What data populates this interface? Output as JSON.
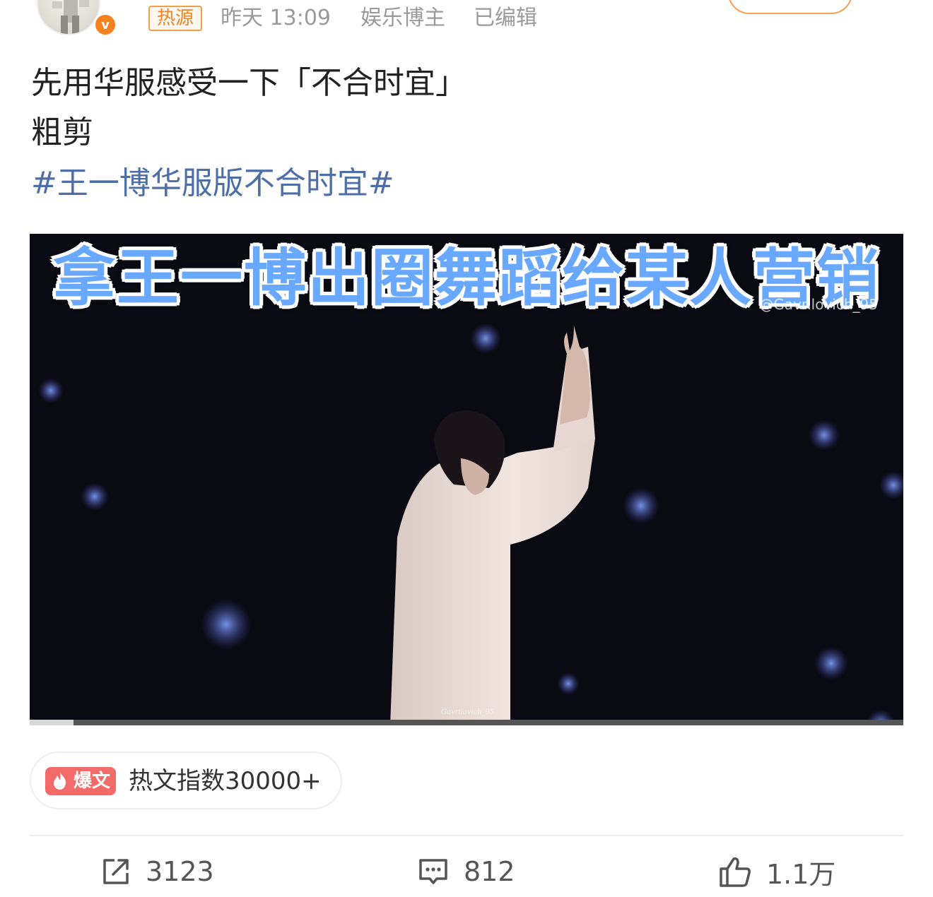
{
  "post": {
    "hot_tag": "热源",
    "time": "昨天 13:09",
    "role": "娱乐博主",
    "edited": "已编辑",
    "verified_badge": "v",
    "text_line1": "先用华服感受一下「不合时宜」",
    "text_line2": "粗剪",
    "hashtag": "#王一博华服版不合时宜#"
  },
  "video": {
    "overlay_title": "拿王一博出圈舞蹈给某人营销",
    "watermark_text": "@Gavrilovich_95",
    "watermark_bottom": "Gavrilovich_95",
    "progress": 0.05
  },
  "hot_badge": {
    "label": "爆文",
    "index_text": "热文指数30000+"
  },
  "actions": {
    "repost_count": "3123",
    "comment_count": "812",
    "like_count": "1.1万"
  },
  "icons": {
    "repost": "repost-icon",
    "comment": "comment-icon",
    "like": "thumbs-up-icon",
    "flame": "flame-icon"
  },
  "colors": {
    "accent_orange": "#f6821f",
    "hashtag_blue": "#4e6ea6",
    "baowen_red": "#f36b68",
    "overlay_blue": "#69a8ff"
  }
}
